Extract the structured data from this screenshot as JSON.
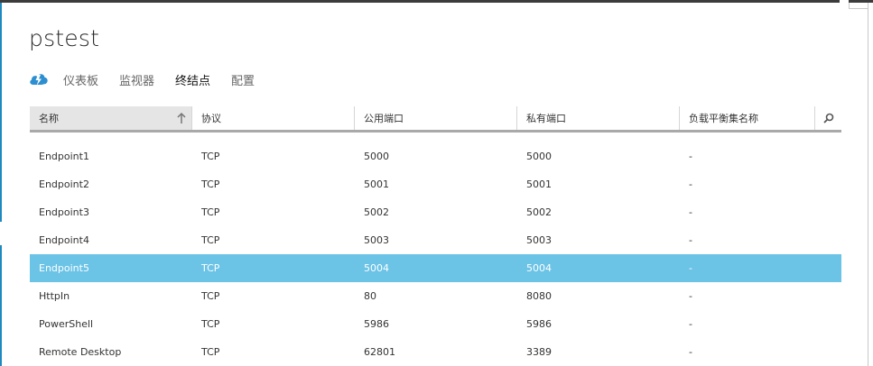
{
  "page": {
    "title": "pstest"
  },
  "nav": {
    "icon": "cloud-service-icon",
    "tabs": [
      {
        "label": "仪表板",
        "active": false
      },
      {
        "label": "监视器",
        "active": false
      },
      {
        "label": "终结点",
        "active": true
      },
      {
        "label": "配置",
        "active": false
      }
    ]
  },
  "table": {
    "columns": [
      "名称",
      "协议",
      "公用端口",
      "私有端口",
      "负载平衡集名称"
    ],
    "sorted_column": "名称",
    "sort_direction": "ascending",
    "search_icon": "search-icon",
    "rows": [
      {
        "name": "Endpoint1",
        "protocol": "TCP",
        "public_port": "5000",
        "private_port": "5000",
        "lb_set": "-",
        "selected": false
      },
      {
        "name": "Endpoint2",
        "protocol": "TCP",
        "public_port": "5001",
        "private_port": "5001",
        "lb_set": "-",
        "selected": false
      },
      {
        "name": "Endpoint3",
        "protocol": "TCP",
        "public_port": "5002",
        "private_port": "5002",
        "lb_set": "-",
        "selected": false
      },
      {
        "name": "Endpoint4",
        "protocol": "TCP",
        "public_port": "5003",
        "private_port": "5003",
        "lb_set": "-",
        "selected": false
      },
      {
        "name": "Endpoint5",
        "protocol": "TCP",
        "public_port": "5004",
        "private_port": "5004",
        "lb_set": "-",
        "selected": true
      },
      {
        "name": "HttpIn",
        "protocol": "TCP",
        "public_port": "80",
        "private_port": "8080",
        "lb_set": "-",
        "selected": false
      },
      {
        "name": "PowerShell",
        "protocol": "TCP",
        "public_port": "5986",
        "private_port": "5986",
        "lb_set": "-",
        "selected": false
      },
      {
        "name": "Remote Desktop",
        "protocol": "TCP",
        "public_port": "62801",
        "private_port": "3389",
        "lb_set": "-",
        "selected": false
      }
    ]
  },
  "colors": {
    "accent": "#1f88be",
    "selected_row": "#6bc3e6",
    "sorted_header": "#e5e5e5"
  }
}
